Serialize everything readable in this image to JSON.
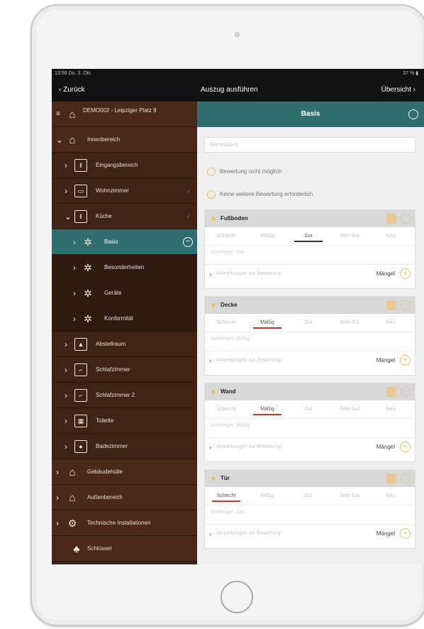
{
  "status_bar": {
    "time": "13:58 Do. 3. Okt.",
    "indicators": "37 %"
  },
  "nav_bar": {
    "back_label": "Zurück",
    "title": "Auszug ausführen",
    "overview_label": "Übersicht"
  },
  "sidebar": {
    "items": [
      {
        "label": "DEMO002 - Leipziger Platz 9",
        "icon": "home-icon"
      },
      {
        "label": "Innenbereich",
        "icon": "house-icon"
      },
      {
        "label": "Eingangsbereich",
        "icon": "door-icon"
      },
      {
        "label": "Wohnzimmer",
        "icon": "sofa-icon"
      },
      {
        "label": "Küche",
        "icon": "kitchen-icon"
      },
      {
        "label": "Basis",
        "icon": "gear-icon"
      },
      {
        "label": "Besonderheiten",
        "icon": "gear-icon"
      },
      {
        "label": "Geräte",
        "icon": "gear-icon"
      },
      {
        "label": "Konformität",
        "icon": "gear-icon"
      },
      {
        "label": "Abstellraum",
        "icon": "storage-icon"
      },
      {
        "label": "Schlafzimmer",
        "icon": "bed-icon"
      },
      {
        "label": "Schlafzimmer 2",
        "icon": "bed-icon"
      },
      {
        "label": "Toilette",
        "icon": "toilet-icon"
      },
      {
        "label": "Badezimmer",
        "icon": "bath-icon"
      },
      {
        "label": "Gebäudehülle",
        "icon": "house-icon"
      },
      {
        "label": "Außenbereich",
        "icon": "outdoor-icon"
      },
      {
        "label": "Technische Installationen",
        "icon": "settings-icon"
      },
      {
        "label": "Schlüssel",
        "icon": "key-icon"
      }
    ]
  },
  "main": {
    "title": "Basis",
    "remark_placeholder": "Anmerkung",
    "options": [
      "Bewertung nicht möglich",
      "Keine weitere Bewertung erforderlich"
    ],
    "rating_labels": [
      "Schlecht",
      "Mäßig",
      "Gut",
      "Sehr Gut",
      "Neu"
    ],
    "remarks_label": "Anmerkungen zur Bewertung",
    "defects_label": "Mängel",
    "cards": [
      {
        "title": "Fußboden",
        "selected": "Gut",
        "previous": "Vorheriger: Gut"
      },
      {
        "title": "Decke",
        "selected": "Mäßig",
        "previous": "Vorheriger: Mäßig"
      },
      {
        "title": "Wand",
        "selected": "Mäßig",
        "previous": "Vorheriger: Mäßig"
      },
      {
        "title": "Tür",
        "selected": "Schlecht",
        "previous": "Vorheriger: Gut"
      }
    ]
  },
  "colors": {
    "accent_teal": "#2e6e6e",
    "sidebar_brown": "#3b2318",
    "highlight_yellow": "#f0c060",
    "selection_red": "#c0392b"
  }
}
